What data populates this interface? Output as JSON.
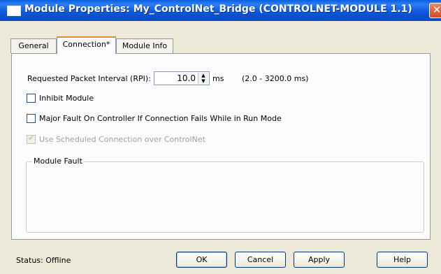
{
  "window": {
    "title": "Module Properties: My_ControlNet_Bridge (CONTROLNET-MODULE 1.1)",
    "close_glyph": "✕"
  },
  "tabs": [
    {
      "label": "General"
    },
    {
      "label": "Connection*"
    },
    {
      "label": "Module Info"
    }
  ],
  "connection": {
    "rpi_label": "Requested Packet Interval (RPI):",
    "rpi_value": "10.0",
    "rpi_unit": "ms",
    "rpi_range": "(2.0 - 3200.0 ms)",
    "inhibit_label": "Inhibit Module",
    "major_fault_label": "Major Fault On Controller If Connection Fails While in Run Mode",
    "scheduled_label": "Use Scheduled Connection over ControlNet",
    "scheduled_checked": true,
    "module_fault_title": "Module Fault"
  },
  "footer": {
    "status": "Status:  Offline",
    "ok": "OK",
    "cancel": "Cancel",
    "apply": "Apply",
    "help": "Help"
  }
}
